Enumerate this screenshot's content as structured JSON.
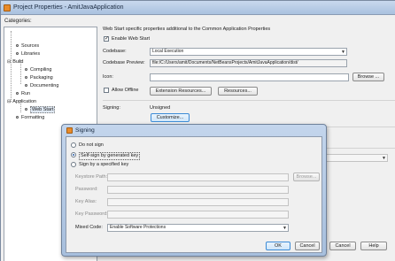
{
  "window": {
    "title": "Project Properties - AmitJavaApplication"
  },
  "categories": {
    "label": "Categories:",
    "items": [
      {
        "label": "Sources"
      },
      {
        "label": "Libraries"
      },
      {
        "label": "Build"
      },
      {
        "label": "Compiling"
      },
      {
        "label": "Packaging"
      },
      {
        "label": "Documenting"
      },
      {
        "label": "Run"
      },
      {
        "label": "Application"
      },
      {
        "label": "Web Start"
      },
      {
        "label": "Formatting"
      }
    ]
  },
  "webstart": {
    "description": "Web Start specific properties additional to the Common Application Properties",
    "enable_label": "Enable Web Start",
    "codebase_label": "Codebase:",
    "codebase_value": "Local Execution",
    "preview_label": "Codebase Preview:",
    "preview_value": "file:/C:/Users/amit/Documents/NetBeansProjects/AmitJavaApplication/dist/",
    "icon_label": "Icon:",
    "browse_label": "Browse ...",
    "offline_label": "Allow Offline",
    "ext_resources_label": "Extension Resources...",
    "resources_label": "Resources...",
    "signing_label": "Signing:",
    "signing_value": "Unsigned",
    "customize_label": "Customize..."
  },
  "outer_buttons": {
    "cancel": "Cancel",
    "help": "Help"
  },
  "signing_dialog": {
    "title": "Signing",
    "option_none": "Do not sign",
    "option_self": "Self-sign by generated key",
    "option_key": "Sign by a specified key",
    "keystore_label": "Keystore Path:",
    "browse_label": "Browse...",
    "password_label": "Password:",
    "alias_label": "Key Alias:",
    "keypass_label": "Key Password:",
    "mixed_label": "Mixed Code:",
    "mixed_value": "Enable Software Protections",
    "ok": "OK",
    "cancel": "Cancel"
  }
}
